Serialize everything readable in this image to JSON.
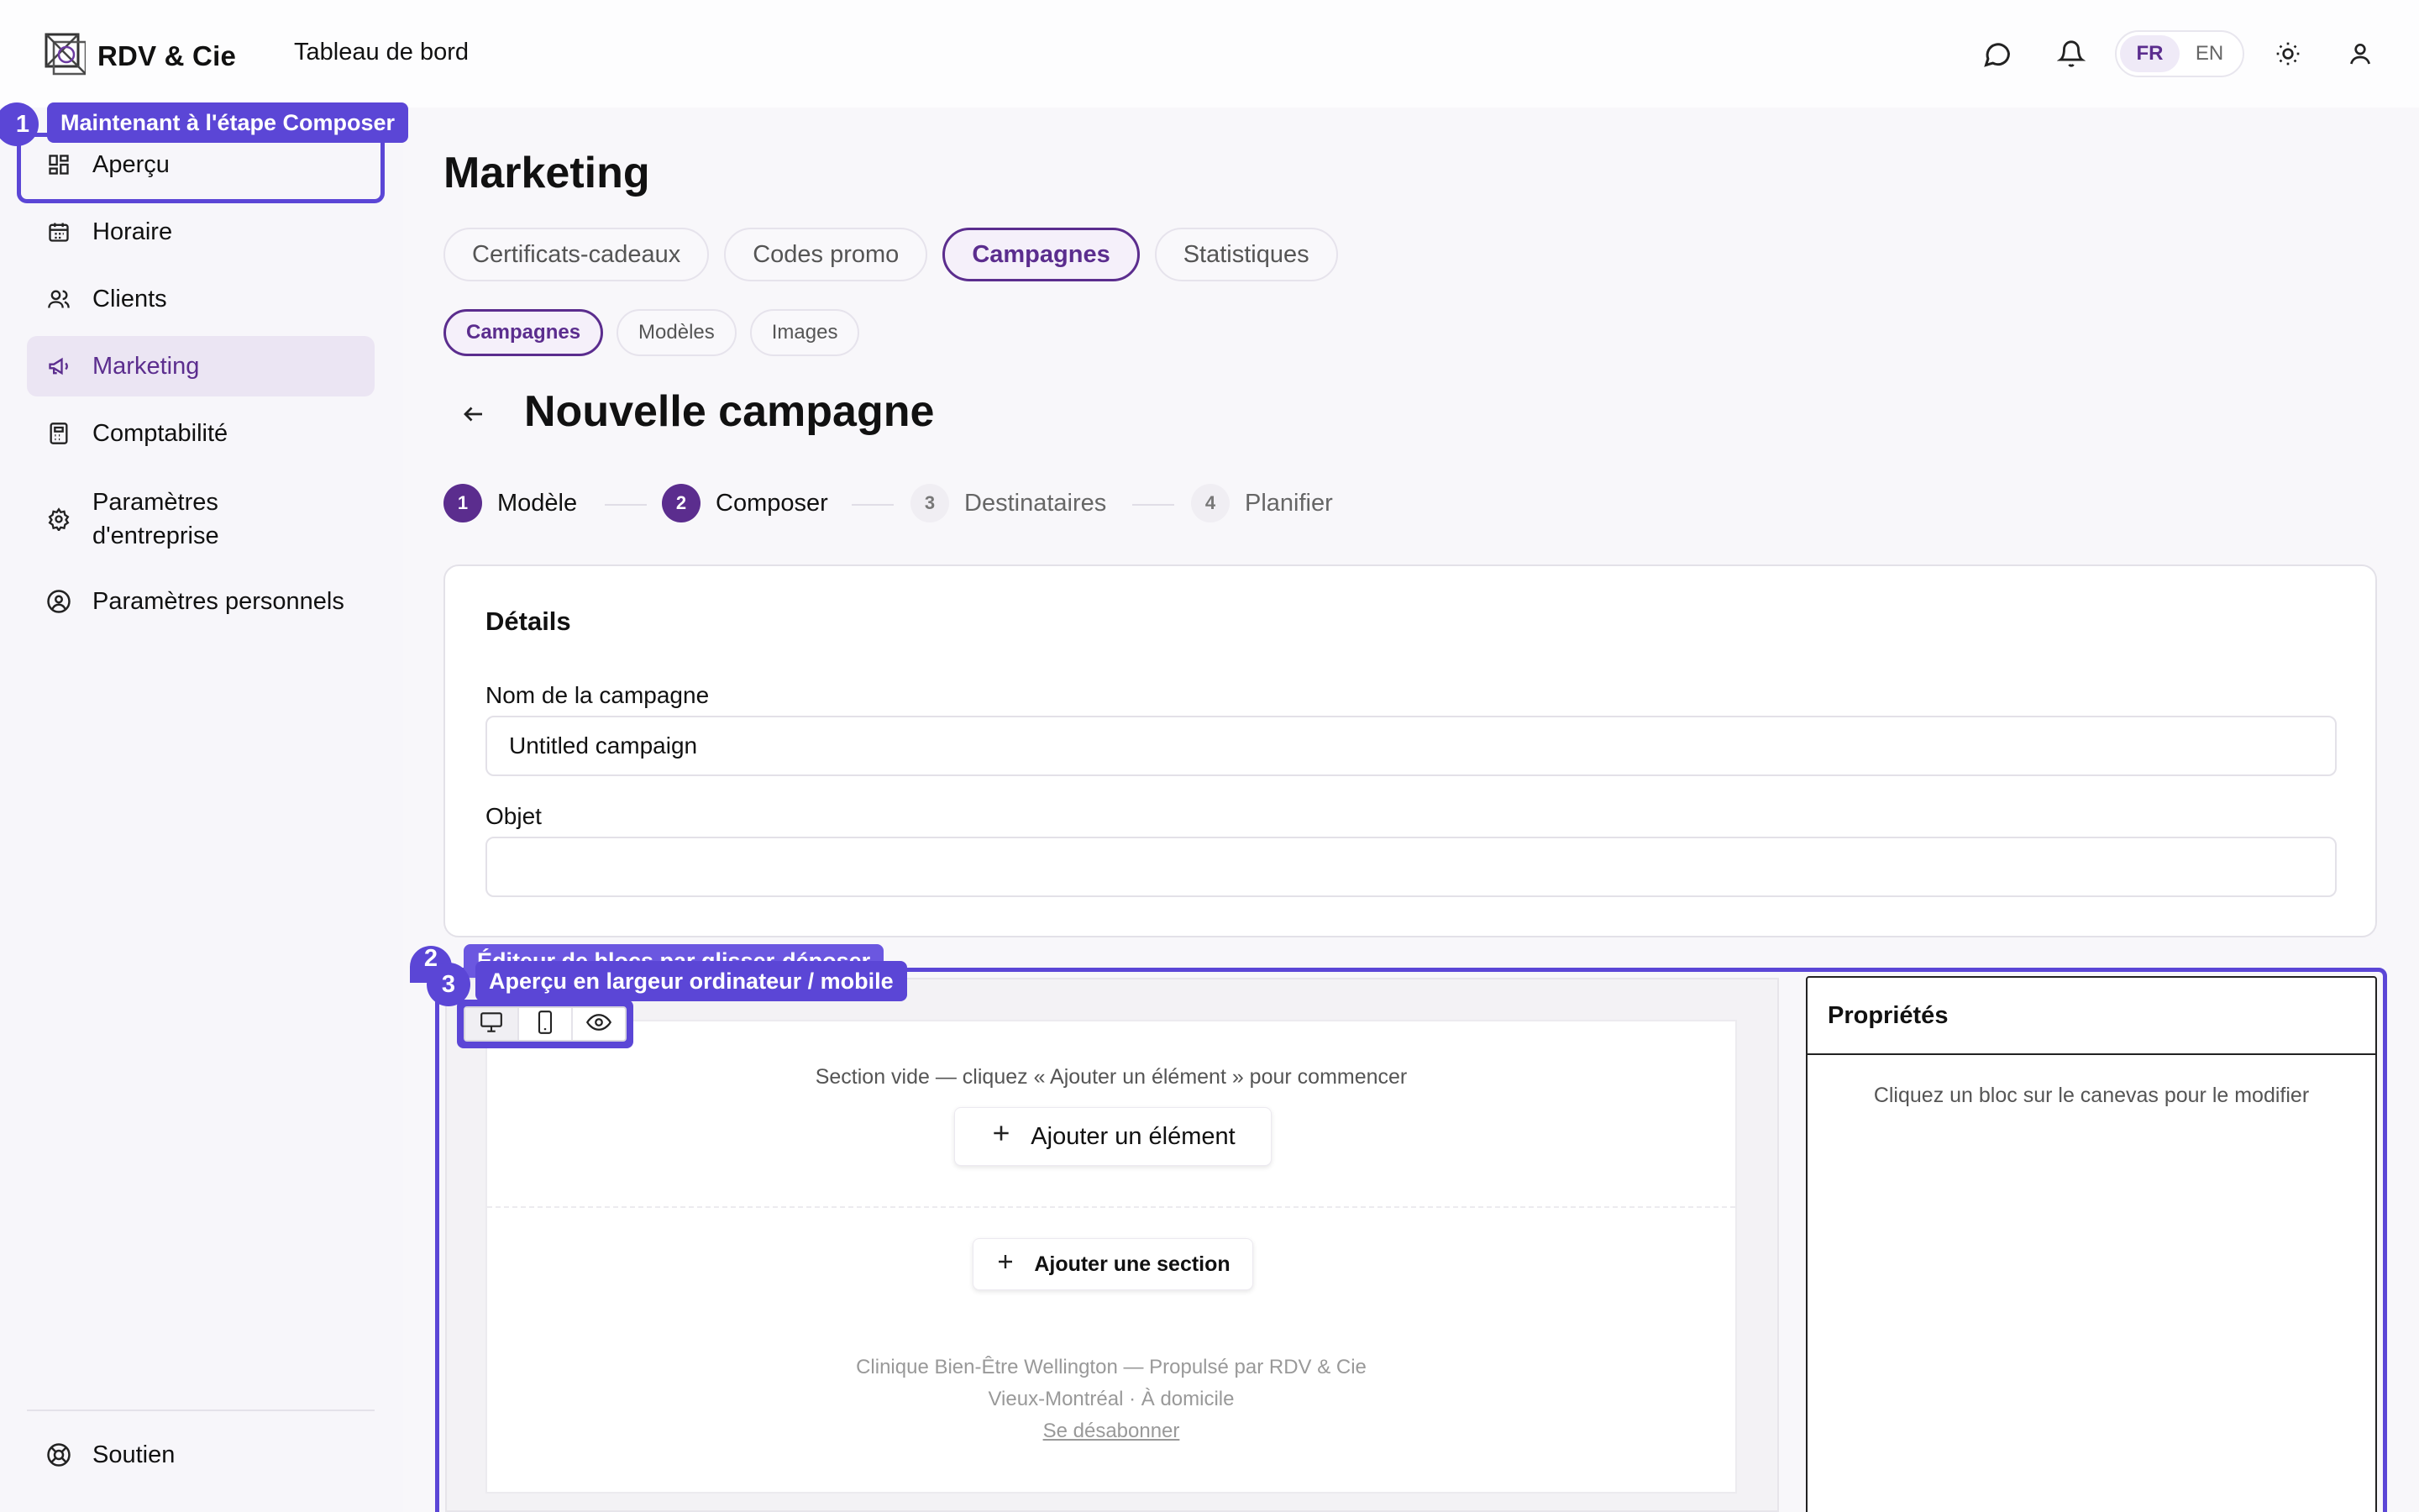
{
  "app": {
    "name": "RDV & Cie",
    "page": "Tableau de bord"
  },
  "lang": {
    "fr": "FR",
    "en": "EN",
    "selected": "FR"
  },
  "sidebar": {
    "items": [
      {
        "label": "Aperçu",
        "icon": "dashboard-icon"
      },
      {
        "label": "Horaire",
        "icon": "calendar-icon"
      },
      {
        "label": "Clients",
        "icon": "users-icon"
      },
      {
        "label": "Marketing",
        "icon": "megaphone-icon",
        "active": true
      },
      {
        "label": "Comptabilité",
        "icon": "calculator-icon"
      },
      {
        "label": "Paramètres d'entreprise",
        "icon": "gear-icon"
      },
      {
        "label": "Paramètres personnels",
        "icon": "user-circle-icon"
      }
    ],
    "support": "Soutien"
  },
  "main": {
    "title": "Marketing",
    "tabs": [
      "Certificats-cadeaux",
      "Codes promo",
      "Campagnes",
      "Statistiques"
    ],
    "active_tab": "Campagnes",
    "subtabs": [
      "Campagnes",
      "Modèles",
      "Images"
    ],
    "active_subtab": "Campagnes",
    "campaign_title": "Nouvelle campagne",
    "steps": [
      {
        "num": "1",
        "label": "Modèle",
        "state": "done"
      },
      {
        "num": "2",
        "label": "Composer",
        "state": "current"
      },
      {
        "num": "3",
        "label": "Destinataires",
        "state": "todo"
      },
      {
        "num": "4",
        "label": "Planifier",
        "state": "todo"
      }
    ]
  },
  "details": {
    "title": "Détails",
    "name_label": "Nom de la campagne",
    "name_value": "Untitled campaign",
    "subject_label": "Objet",
    "subject_value": ""
  },
  "editor": {
    "empty_section": "Section vide — cliquez « Ajouter un élément » pour commencer",
    "add_element": "Ajouter un élément",
    "add_section": "Ajouter une section",
    "footer": [
      "Clinique Bien-Être Wellington — Propulsé par RDV & Cie",
      "Vieux-Montréal · À domicile"
    ],
    "unsubscribe": "Se désabonner",
    "properties_title": "Propriétés",
    "properties_hint": "Cliquez un bloc sur le canevas pour le modifier"
  },
  "tour": {
    "step1": {
      "num": "1",
      "text": "Maintenant à l'étape Composer"
    },
    "step2": {
      "num": "2",
      "text": "Éditeur de blocs par glisser-déposer"
    },
    "step3": {
      "num": "3",
      "text": "Aperçu en largeur ordinateur / mobile"
    }
  },
  "colors": {
    "accent": "#5b2d8e",
    "tour": "#5b46d6"
  }
}
